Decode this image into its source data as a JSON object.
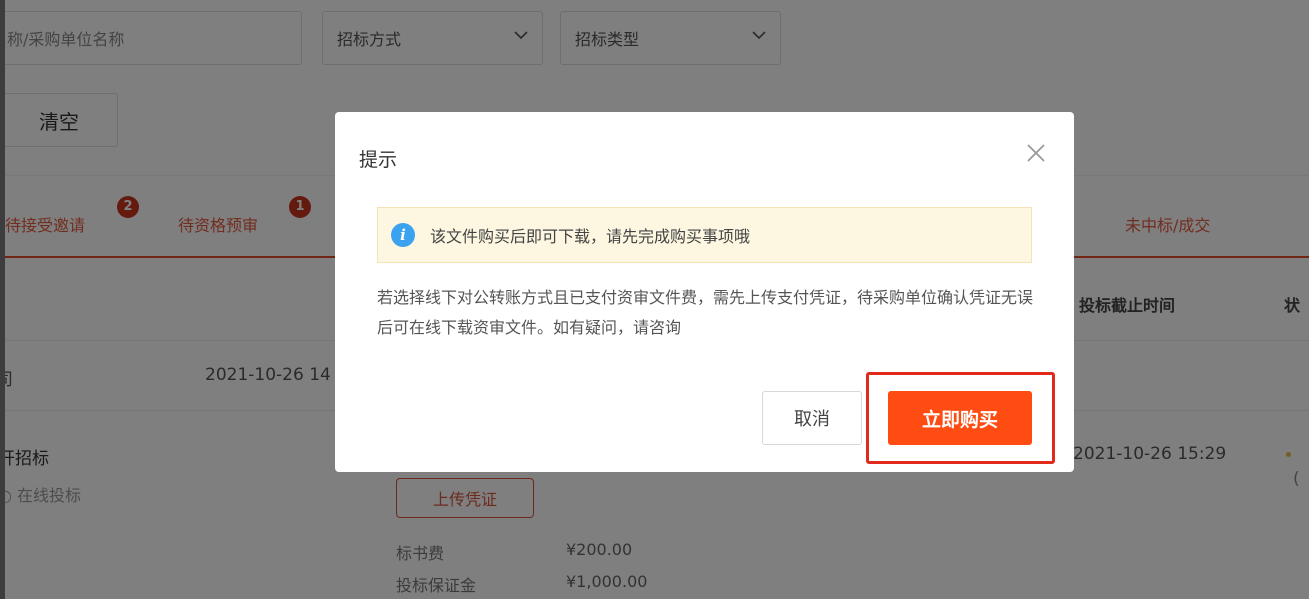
{
  "filters": {
    "keyword_placeholder": "称/采购单位名称",
    "method_select": "招标方式",
    "type_select": "招标类型",
    "clear_label": "清空"
  },
  "tabs": [
    {
      "label": "待接受邀请",
      "badge": "2"
    },
    {
      "label": "待资格预审",
      "badge": "1"
    },
    {
      "label": "未中标/成交",
      "badge": ""
    }
  ],
  "table": {
    "headers": [
      "投标截止时间",
      "状"
    ],
    "rows": [
      {
        "company": "司",
        "date": "2021-10-26 14"
      },
      {
        "project": "开招标",
        "mode": "在线投标",
        "deadline": "2021-10-26 15:29",
        "status_paren": "("
      }
    ],
    "upload_label": "上传凭证",
    "fees": [
      {
        "label": "标书费",
        "value": "¥200.00"
      },
      {
        "label": "投标保证金",
        "value": "¥1,000.00"
      }
    ]
  },
  "dialog": {
    "title": "提示",
    "info_text": "该文件购买后即可下载，请先完成购买事项哦",
    "desc": "若选择线下对公转账方式且已支付资审文件费，需先上传支付凭证，待采购单位确认凭证无误后可在线下载资审文件。如有疑问，请咨询",
    "cancel_label": "取消",
    "buy_label": "立即购买"
  },
  "colors": {
    "accent": "#ff4c12",
    "tab_red": "#e04a2a",
    "info_blue": "#3ba2f0",
    "highlight": "#e12a1c"
  }
}
